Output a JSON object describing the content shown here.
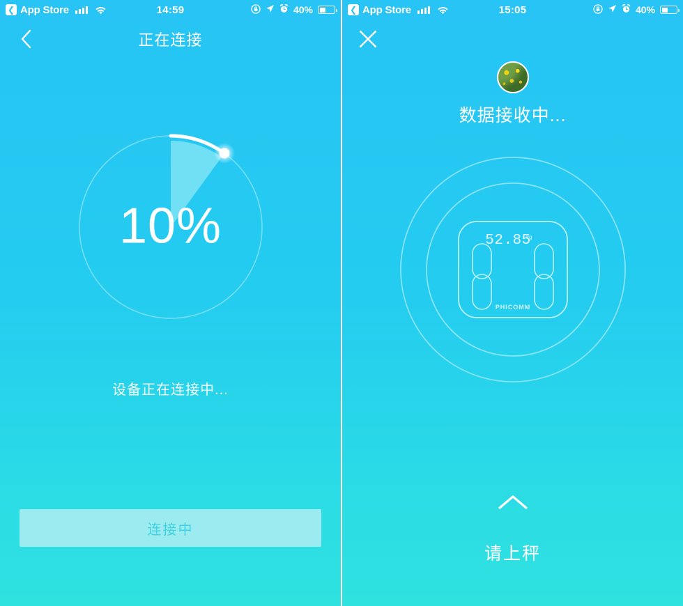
{
  "theme": {
    "bg_top": "#27C4F5",
    "bg_bottom": "#2FE2E0",
    "accent_white": "#FFFFFF",
    "button_bg": "#9BEBF0",
    "button_text": "#3FD2E0",
    "wedge_fill": "#7FE4F5"
  },
  "left_panel": {
    "status_bar": {
      "back_chip_icon": "chevron-left-icon",
      "carrier_app": "App Store",
      "signal_icon": "signal-bars-icon",
      "wifi_icon": "wifi-icon",
      "time": "14:59",
      "rotation_lock_icon": "rotation-lock-icon",
      "location_icon": "location-arrow-icon",
      "alarm_icon": "alarm-clock-icon",
      "battery_percent": "40%",
      "battery_icon": "battery-icon"
    },
    "nav": {
      "back_icon": "chevron-left-icon",
      "title": "正在连接"
    },
    "progress": {
      "percent_label": "10%",
      "percent_value": 10,
      "track_color": "#6EDCF2",
      "arc_color": "#FFFFFF",
      "knob_icon": "progress-knob"
    },
    "status_text": "设备正在连接中...",
    "action_button": {
      "label": "连接中",
      "state": "disabled"
    }
  },
  "right_panel": {
    "status_bar": {
      "back_chip_icon": "chevron-left-icon",
      "carrier_app": "App Store",
      "signal_icon": "signal-bars-icon",
      "wifi_icon": "wifi-icon",
      "time": "15:05",
      "rotation_lock_icon": "rotation-lock-icon",
      "location_icon": "location-arrow-icon",
      "alarm_icon": "alarm-clock-icon",
      "battery_percent": "40%",
      "battery_icon": "battery-icon"
    },
    "nav": {
      "close_icon": "close-icon"
    },
    "avatar": {
      "icon": "user-avatar",
      "description": "photo"
    },
    "title": "数据接收中...",
    "scale": {
      "icon": "body-scale-illustration",
      "display_value": "52.85",
      "display_unit": "kg",
      "brand": "PHICOMM",
      "ripple_rings": 2
    },
    "prompt": {
      "arrow_icon": "chevron-up-icon",
      "text": "请上秤"
    }
  }
}
